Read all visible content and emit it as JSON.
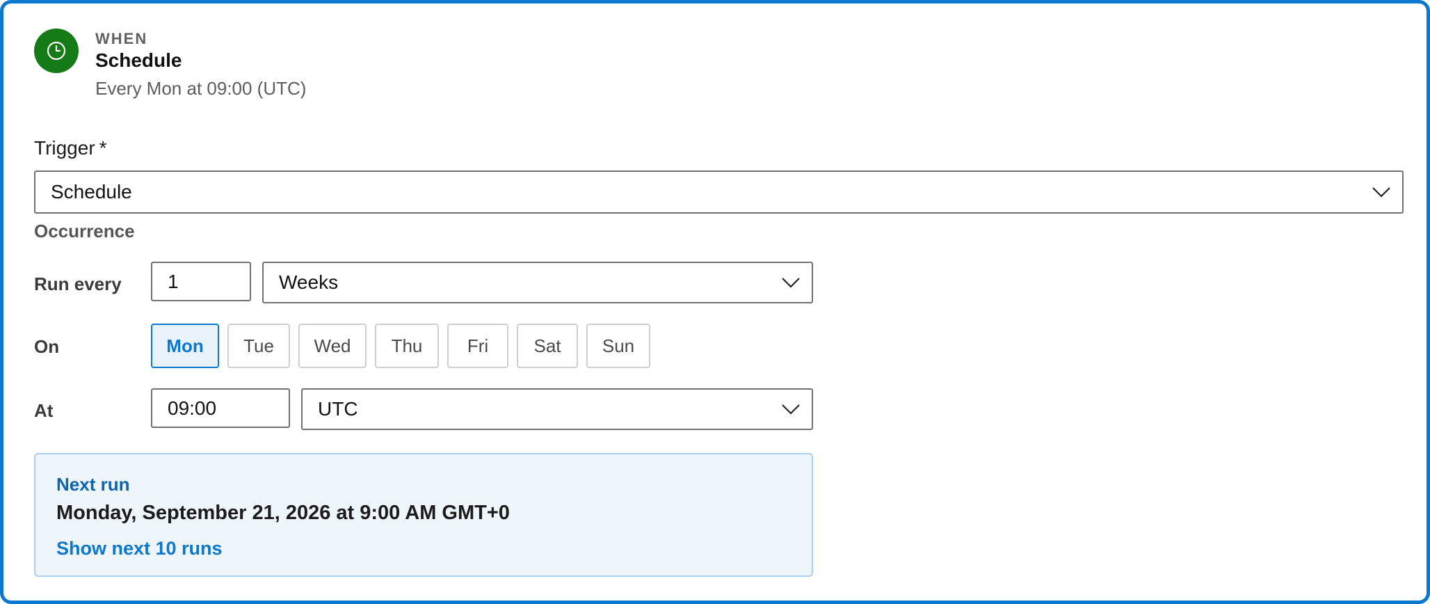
{
  "header": {
    "icon": "clock-icon",
    "icon_bg_color": "#157b17",
    "kicker": "WHEN",
    "title": "Schedule",
    "summary": "Every Mon at 09:00 (UTC)"
  },
  "trigger": {
    "label": "Trigger",
    "required_marker": "*",
    "selected": "Schedule"
  },
  "occurrence": {
    "heading": "Occurrence",
    "run_every": {
      "label": "Run every",
      "interval": "1",
      "unit": "Weeks"
    },
    "on": {
      "label": "On",
      "days": [
        {
          "label": "Mon",
          "selected": true
        },
        {
          "label": "Tue",
          "selected": false
        },
        {
          "label": "Wed",
          "selected": false
        },
        {
          "label": "Thu",
          "selected": false
        },
        {
          "label": "Fri",
          "selected": false
        },
        {
          "label": "Sat",
          "selected": false
        },
        {
          "label": "Sun",
          "selected": false
        }
      ]
    },
    "at": {
      "label": "At",
      "time": "09:00",
      "timezone": "UTC"
    }
  },
  "next_run": {
    "title": "Next run",
    "date": "Monday, September 21, 2026 at 9:00 AM GMT+0",
    "show_more_link": "Show next 10 runs"
  },
  "colors": {
    "accent": "#0a78cf",
    "selected_day_bg": "#e8f2fb",
    "panel_bg": "#eef5fb"
  }
}
